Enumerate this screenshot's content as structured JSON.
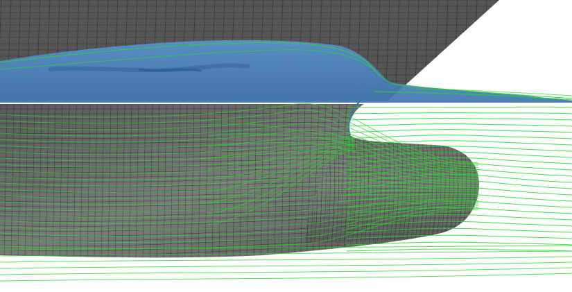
{
  "scene": {
    "subject": "",
    "colors": {
      "background": "#ffffff",
      "hull": "#6e6e6e",
      "hull_dark": "#4f4f4f",
      "hull_light": "#8c8c8c",
      "mesh": "#111111",
      "free_surface": "#4f86c4",
      "free_surface_dark": "#3b6ea8",
      "streamline": "#22dd22"
    }
  }
}
